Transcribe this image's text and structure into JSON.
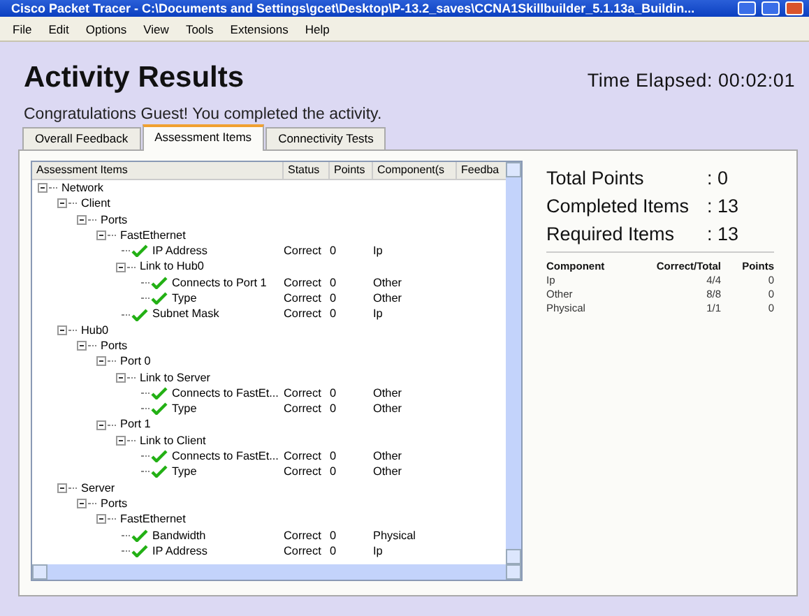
{
  "window": {
    "title": "Cisco Packet Tracer - C:\\Documents and Settings\\gcet\\Desktop\\P-13.2_saves\\CCNA1Skillbuilder_5.1.13a_Buildin..."
  },
  "menu": [
    "File",
    "Edit",
    "Options",
    "View",
    "Tools",
    "Extensions",
    "Help"
  ],
  "heading": "Activity Results",
  "time_elapsed": "Time Elapsed: 00:02:01",
  "message": "Congratulations Guest! You completed the activity.",
  "tabs": [
    {
      "label": "Overall Feedback",
      "selected": false
    },
    {
      "label": "Assessment Items",
      "selected": true
    },
    {
      "label": "Connectivity Tests",
      "selected": false
    }
  ],
  "tree": {
    "columns": [
      "Assessment Items",
      "Status",
      "Points",
      "Component(s",
      "Feedba"
    ],
    "items": [
      {
        "label": "Network",
        "expanded": true,
        "children": [
          {
            "label": "Client",
            "expanded": true,
            "children": [
              {
                "label": "Ports",
                "expanded": true,
                "children": [
                  {
                    "label": "FastEthernet",
                    "expanded": true,
                    "children": [
                      {
                        "label": "IP Address",
                        "passed": true,
                        "status": "Correct",
                        "points": "0",
                        "component": "Ip"
                      },
                      {
                        "label": "Link to Hub0",
                        "expanded": true,
                        "children": [
                          {
                            "label": "Connects to Port 1",
                            "passed": true,
                            "status": "Correct",
                            "points": "0",
                            "component": "Other"
                          },
                          {
                            "label": "Type",
                            "passed": true,
                            "status": "Correct",
                            "points": "0",
                            "component": "Other"
                          }
                        ]
                      },
                      {
                        "label": "Subnet Mask",
                        "passed": true,
                        "status": "Correct",
                        "points": "0",
                        "component": "Ip"
                      }
                    ]
                  }
                ]
              }
            ]
          },
          {
            "label": "Hub0",
            "expanded": true,
            "children": [
              {
                "label": "Ports",
                "expanded": true,
                "children": [
                  {
                    "label": "Port 0",
                    "expanded": true,
                    "children": [
                      {
                        "label": "Link to Server",
                        "expanded": true,
                        "children": [
                          {
                            "label": "Connects to FastEt...",
                            "passed": true,
                            "status": "Correct",
                            "points": "0",
                            "component": "Other"
                          },
                          {
                            "label": "Type",
                            "passed": true,
                            "status": "Correct",
                            "points": "0",
                            "component": "Other"
                          }
                        ]
                      }
                    ]
                  },
                  {
                    "label": "Port 1",
                    "expanded": true,
                    "children": [
                      {
                        "label": "Link to Client",
                        "expanded": true,
                        "children": [
                          {
                            "label": "Connects to FastEt...",
                            "passed": true,
                            "status": "Correct",
                            "points": "0",
                            "component": "Other"
                          },
                          {
                            "label": "Type",
                            "passed": true,
                            "status": "Correct",
                            "points": "0",
                            "component": "Other"
                          }
                        ]
                      }
                    ]
                  }
                ]
              }
            ]
          },
          {
            "label": "Server",
            "expanded": true,
            "children": [
              {
                "label": "Ports",
                "expanded": true,
                "children": [
                  {
                    "label": "FastEthernet",
                    "expanded": true,
                    "children": [
                      {
                        "label": "Bandwidth",
                        "passed": true,
                        "status": "Correct",
                        "points": "0",
                        "component": "Physical"
                      },
                      {
                        "label": "IP Address",
                        "passed": true,
                        "status": "Correct",
                        "points": "0",
                        "component": "Ip"
                      }
                    ]
                  }
                ]
              }
            ]
          }
        ]
      }
    ]
  },
  "summary": {
    "stats": [
      {
        "label": "Total Points",
        "value": ": 0"
      },
      {
        "label": "Completed Items",
        "value": ": 13"
      },
      {
        "label": "Required Items",
        "value": ": 13"
      }
    ],
    "table": {
      "columns": [
        "Component",
        "Correct/Total",
        "Points"
      ],
      "rows": [
        [
          "Ip",
          "4/4",
          "0"
        ],
        [
          "Other",
          "8/8",
          "0"
        ],
        [
          "Physical",
          "1/1",
          "0"
        ]
      ]
    }
  }
}
